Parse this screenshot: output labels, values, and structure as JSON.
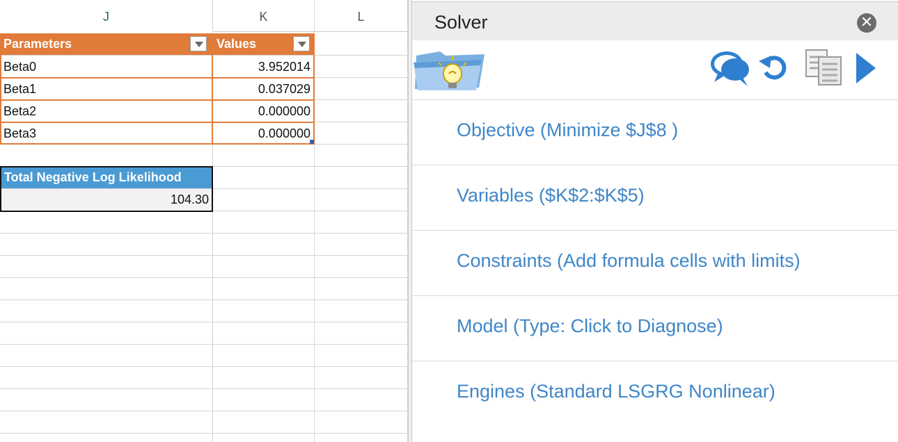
{
  "sheet": {
    "columns": [
      "J",
      "K",
      "L"
    ],
    "table": {
      "headers": [
        "Parameters",
        "Values"
      ],
      "rows": [
        {
          "param": "Beta0",
          "value": "3.952014"
        },
        {
          "param": "Beta1",
          "value": "0.037029"
        },
        {
          "param": "Beta2",
          "value": "0.000000"
        },
        {
          "param": "Beta3",
          "value": "0.000000"
        }
      ]
    },
    "total": {
      "label": "Total Negative Log Likelihood",
      "value": "104.30"
    },
    "colors": {
      "table_header": "#e07b39",
      "total_header": "#4a9ad4",
      "active_column": "#1e7145"
    }
  },
  "solver": {
    "title": "Solver",
    "close_icon": "close-icon",
    "toolbar_icons": [
      "speech-bubble-icon",
      "reset-icon",
      "copy-icon",
      "solve-play-icon"
    ],
    "sections": [
      {
        "label": "Objective (Minimize $J$8 )"
      },
      {
        "label": "Variables ($K$2:$K$5)"
      },
      {
        "label": "Constraints (Add formula cells with limits)"
      },
      {
        "label": "Model (Type: Click to Diagnose)"
      },
      {
        "label": "Engines (Standard LSGRG Nonlinear)"
      }
    ],
    "colors": {
      "link": "#3f86c8",
      "titlebar": "#ececec"
    }
  }
}
